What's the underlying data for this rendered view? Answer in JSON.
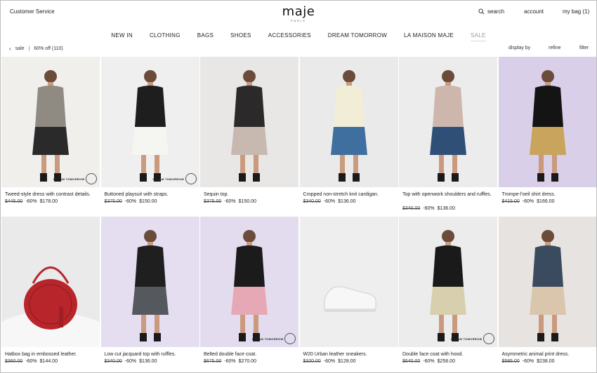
{
  "header": {
    "customer_service": "Customer Service",
    "brand": "maje",
    "brand_sub": "PARIS",
    "search": "search",
    "account": "account",
    "bag": "my bag (1)"
  },
  "nav": [
    "NEW IN",
    "CLOTHING",
    "BAGS",
    "SHOES",
    "ACCESSORIES",
    "DREAM TOMORROW",
    "LA MAISON MAJE",
    "SALE"
  ],
  "subbar": {
    "crumb": "sale",
    "filter_label": "60% off (110)",
    "display": "display by",
    "refine": "refine",
    "filter": "filter"
  },
  "watermark": "DREAM TOMORROW",
  "products": [
    {
      "name": "Tweed-style dress with contrast details.",
      "old": "$445.00",
      "pct": "-60%",
      "price": "$178.00",
      "colors": {
        "bg": "#f1efec",
        "fig": "#8f8a82",
        "accent": "#2a2a2a"
      }
    },
    {
      "name": "Buttoned playsuit with straps.",
      "old": "$375.00",
      "pct": "-60%",
      "price": "$150.00",
      "colors": {
        "bg": "#efefef",
        "fig": "#1e1e1e",
        "accent": "#f5f5f2"
      }
    },
    {
      "name": "Sequin top.",
      "old": "$375.00",
      "pct": "-60%",
      "price": "$150.00",
      "colors": {
        "bg": "#e9e7e6",
        "fig": "#2b2929",
        "accent": "#c7b9b0"
      }
    },
    {
      "name": "Cropped non-stretch knit cardigan.",
      "old": "$340.00",
      "pct": "-60%",
      "price": "$136.00",
      "colors": {
        "bg": "#eaeaea",
        "fig": "#f2edd6",
        "accent": "#3f6f9e"
      }
    },
    {
      "name": "Top with openwork shoulders and ruffles.",
      "old": "$340.00",
      "pct": "-60%",
      "price": "$136.00",
      "colors": {
        "bg": "#ececec",
        "fig": "#cdb7ad",
        "accent": "#2f4f77"
      }
    },
    {
      "name": "Trompe-l'oeil shirt dress.",
      "old": "$415.00",
      "pct": "-60%",
      "price": "$166.00",
      "colors": {
        "bg": "#d9cfe9",
        "fig": "#141414",
        "accent": "#c9a45c"
      }
    },
    {
      "name": "Hatbox bag in embossed leather.",
      "old": "$360.00",
      "pct": "-60%",
      "price": "$144.00",
      "colors": {
        "bg": "#eaeaea",
        "fig": "#b8262b",
        "accent": "#f6f6f6"
      }
    },
    {
      "name": "Low cut jacquard top with ruffles.",
      "old": "$340.00",
      "pct": "-60%",
      "price": "$136.00",
      "colors": {
        "bg": "#e4def0",
        "fig": "#1f1f1f",
        "accent": "#55595e"
      }
    },
    {
      "name": "Belted double face coat.",
      "old": "$675.00",
      "pct": "-60%",
      "price": "$270.00",
      "colors": {
        "bg": "#e3dcef",
        "fig": "#1b1b1b",
        "accent": "#e7a8b6"
      }
    },
    {
      "name": "W20 Urban leather sneakers.",
      "old": "$320.00",
      "pct": "-60%",
      "price": "$128.00",
      "colors": {
        "bg": "#eeeeee",
        "fig": "#f7f7f7",
        "accent": "#cfcfcf"
      }
    },
    {
      "name": "Double face coat with hood.",
      "old": "$640.00",
      "pct": "-60%",
      "price": "$256.00",
      "colors": {
        "bg": "#ececec",
        "fig": "#1a1a1a",
        "accent": "#d7cfae"
      }
    },
    {
      "name": "Asymmetric animal print dress.",
      "old": "$595.00",
      "pct": "-60%",
      "price": "$238.00",
      "colors": {
        "bg": "#e6e3e0",
        "fig": "#3a4a5f",
        "accent": "#d9c6ad"
      }
    }
  ]
}
